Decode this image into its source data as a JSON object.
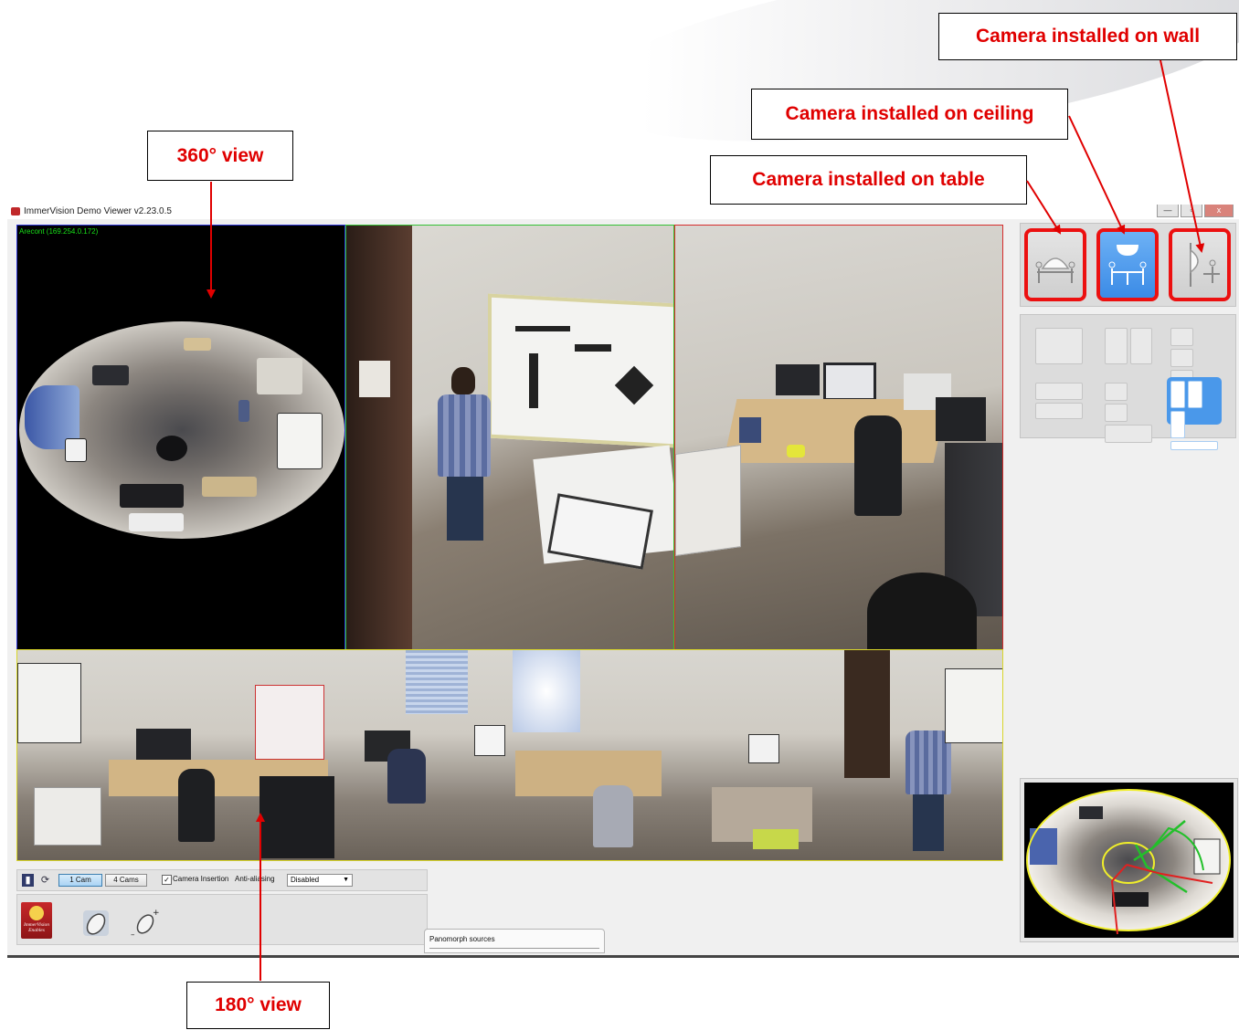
{
  "window": {
    "title": "ImmerVision Demo Viewer v2.23.0.5",
    "controls": [
      "—",
      "▫",
      "x"
    ]
  },
  "callouts": {
    "wall": "Camera installed on wall",
    "ceiling": "Camera installed on ceiling",
    "table": "Camera installed on table",
    "view360": "360° view",
    "view180": "180° view"
  },
  "views": {
    "camera_label": "Arecont (169.254.0.172)"
  },
  "toolbar": {
    "one_cam": "1 Cam",
    "four_cams": "4 Cams",
    "camera_insertion_label": "Camera Insertion",
    "camera_insertion_checked": true,
    "anti_aliasing_label": "Anti-aliasing",
    "anti_aliasing_value": "Disabled"
  },
  "logo": {
    "text": "ImmerVision Enables"
  },
  "popup": {
    "title": "Panomorph sources"
  },
  "mount_modes": [
    "table",
    "ceiling",
    "wall"
  ],
  "mount_selected": "ceiling",
  "layout_selected": 6,
  "colors": {
    "callout_text": "#e00000",
    "highlight_border": "#ec1010",
    "active_button": "#4a98ea",
    "fisheye_border": "#2d35d6",
    "ceiling_border": "#35c235",
    "wall_border": "#d62c2c",
    "pano_border": "#d9d62a",
    "camera_label": "#18e018"
  }
}
